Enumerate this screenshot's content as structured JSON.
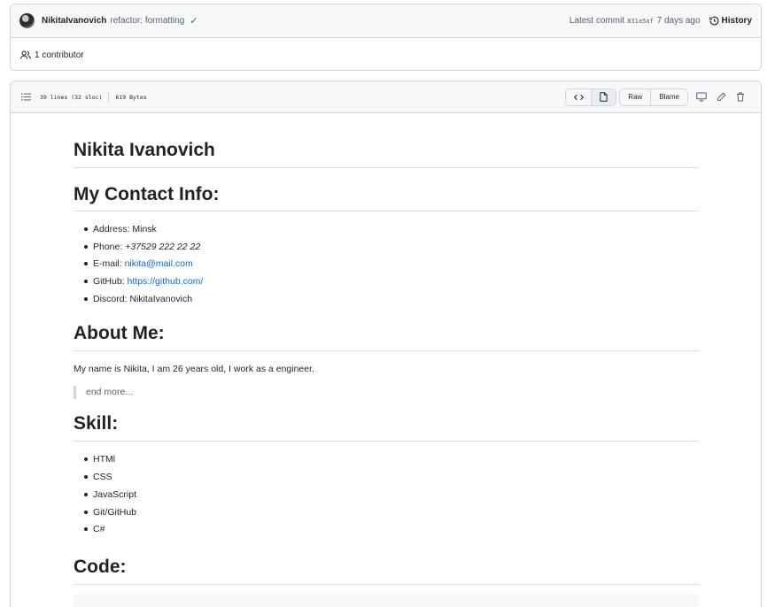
{
  "commit": {
    "author": "NikitaIvanovich",
    "message": "refactor: formatting",
    "status_icon": "check-icon",
    "latest_label": "Latest commit",
    "sha": "831a5af",
    "ago": "7 days ago",
    "history_label": "History",
    "status_color": "#1a7f37"
  },
  "contributors": {
    "label": "1 contributor"
  },
  "file": {
    "lines": "39 lines (32 sloc)",
    "size": "619 Bytes",
    "raw_label": "Raw",
    "blame_label": "Blame"
  },
  "readme": {
    "name_heading": "Nikita Ivanovich",
    "contact_heading": "My Contact Info:",
    "contact": {
      "address_label": "Address:",
      "address": "Minsk",
      "phone_label": "Phone:",
      "phone": "+37529 222 22 22",
      "email_label": "E-mail:",
      "email": "nikita@mail.com",
      "github_label": "GitHub:",
      "github": "https://github.com/",
      "discord_label": "Discord:",
      "discord": "NikitaIvanovich"
    },
    "about_heading": "About Me:",
    "about_text": "My name is Nikita, I am 26 years old, I work as a engineer.",
    "quote": "end more...",
    "skill_heading": "Skill:",
    "skills": [
      "HTMl",
      "CSS",
      "JavaScript",
      "Git/GitHub",
      "C#"
    ],
    "code_heading": "Code:"
  },
  "link_color": "#0969da"
}
